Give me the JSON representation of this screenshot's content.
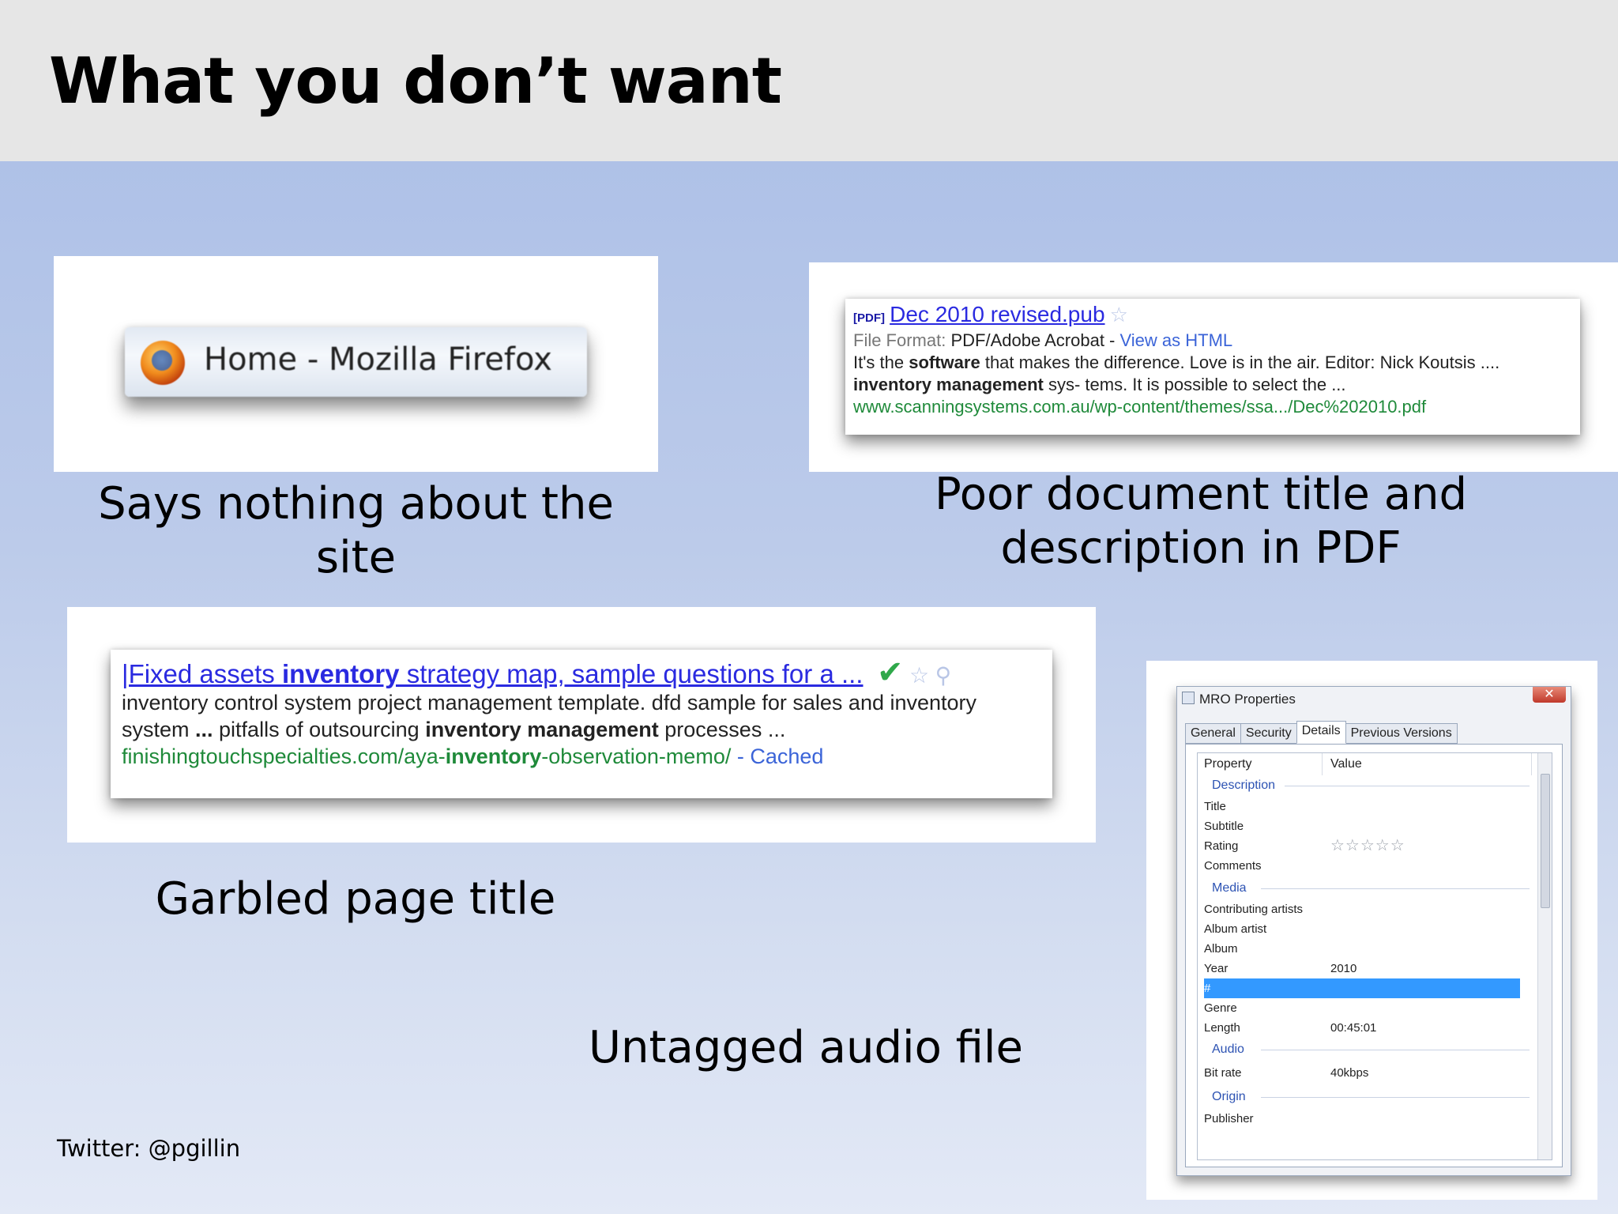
{
  "slide": {
    "title": "What you don’t want",
    "footer": "Twitter: @pgillin"
  },
  "captions": {
    "firefox": "Says nothing about the site",
    "pdf": "Poor document title and description in PDF",
    "garbled": "Garbled page title",
    "audio": "Untagged audio file"
  },
  "firefox_tab": {
    "label": "Home - Mozilla Firefox"
  },
  "pdf_result": {
    "tag": "[PDF]",
    "title": "Dec 2010 revised.pub",
    "format_label": "File Format:",
    "format_value": "PDF/Adobe Acrobat -",
    "view_html": "View as HTML",
    "snippet1_a": "It's the ",
    "snippet1_b": "software",
    "snippet1_c": " that makes the difference. Love is in the air. Editor: Nick Koutsis ....",
    "snippet2_a": "inventory management",
    "snippet2_b": " sys- tems. It is possible to select the ...",
    "url": "www.scanningsystems.com.au/wp-content/themes/ssa.../Dec%202010.pdf"
  },
  "garbled_result": {
    "title_a": "|Fixed assets ",
    "title_b": "inventory",
    "title_c": " strategy map, sample questions for a ...",
    "line1": "inventory control system project management template. dfd sample for sales and inventory",
    "line2_a": "system ",
    "line2_b": "...",
    "line2_c": " pitfalls of outsourcing ",
    "line2_d": "inventory management",
    "line2_e": " processes ...",
    "url_a": "finishingtouchspecialties.com/aya-",
    "url_b": "inventory",
    "url_c": "-observation-memo/",
    "url_sep": " - ",
    "cached": "Cached"
  },
  "properties_window": {
    "title": "MRO Properties",
    "close": "✕",
    "tabs": [
      "General",
      "Security",
      "Details",
      "Previous Versions"
    ],
    "active_tab": "Details",
    "columns": [
      "Property",
      "Value"
    ],
    "groups": {
      "description": "Description",
      "media": "Media",
      "audio": "Audio",
      "origin": "Origin"
    },
    "rows": {
      "title": "Title",
      "subtitle": "Subtitle",
      "rating": "Rating",
      "rating_value": "☆☆☆☆☆",
      "comments": "Comments",
      "contributing_artists": "Contributing artists",
      "album_artist": "Album artist",
      "album": "Album",
      "year": "Year",
      "year_value": "2010",
      "track": "#",
      "genre": "Genre",
      "length": "Length",
      "length_value": "00:45:01",
      "bit_rate": "Bit rate",
      "bit_rate_value": "40kbps",
      "publisher": "Publisher"
    }
  },
  "colors": {
    "title_band": "#e6e6e6",
    "link": "#2a2ae0",
    "url_green": "#1f8a3a",
    "selection": "#3399ff"
  }
}
